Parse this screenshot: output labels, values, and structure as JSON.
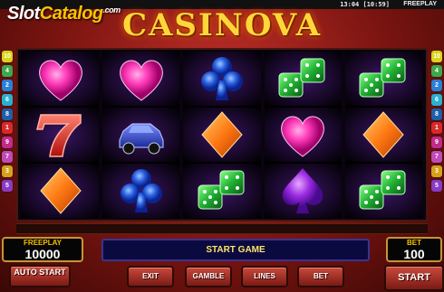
{
  "topbar": {
    "time": "13:04 [10:59]",
    "mode": "FREEPLAY"
  },
  "watermark": {
    "part1": "Slot",
    "part2": "Catalog",
    "suffix": ".com"
  },
  "logo": {
    "text": "CASINOVA"
  },
  "paylines": {
    "left": [
      {
        "n": "10",
        "color": "#d8d31a"
      },
      {
        "n": "4",
        "color": "#3ea84a"
      },
      {
        "n": "2",
        "color": "#2a7fd6"
      },
      {
        "n": "6",
        "color": "#2ab0d0"
      },
      {
        "n": "8",
        "color": "#1e5fa8"
      },
      {
        "n": "1",
        "color": "#d62a2a"
      },
      {
        "n": "9",
        "color": "#c12a8a"
      },
      {
        "n": "7",
        "color": "#c04ab8"
      },
      {
        "n": "3",
        "color": "#d6a21a"
      },
      {
        "n": "5",
        "color": "#8a3ac4"
      }
    ],
    "right": [
      {
        "n": "10",
        "color": "#d8d31a"
      },
      {
        "n": "4",
        "color": "#3ea84a"
      },
      {
        "n": "2",
        "color": "#2a7fd6"
      },
      {
        "n": "6",
        "color": "#2ab0d0"
      },
      {
        "n": "8",
        "color": "#1e5fa8"
      },
      {
        "n": "1",
        "color": "#d62a2a"
      },
      {
        "n": "9",
        "color": "#c12a8a"
      },
      {
        "n": "7",
        "color": "#c04ab8"
      },
      {
        "n": "3",
        "color": "#d6a21a"
      },
      {
        "n": "5",
        "color": "#8a3ac4"
      }
    ]
  },
  "reels": [
    [
      "heart-symbol",
      "seven-symbol",
      "diamond-symbol"
    ],
    [
      "heart-symbol",
      "car-symbol",
      "club-symbol"
    ],
    [
      "club-symbol",
      "diamond-symbol",
      "dice-symbol"
    ],
    [
      "dice-symbol",
      "heart-symbol",
      "spade-symbol"
    ],
    [
      "dice-symbol",
      "diamond-symbol",
      "dice-symbol"
    ]
  ],
  "freeplay": {
    "label": "FREEPLAY",
    "value": "10000"
  },
  "message": "START GAME",
  "bet": {
    "label": "BET",
    "value": "100"
  },
  "buttons": {
    "autostart": "AUTO START",
    "exit": "EXIT",
    "gamble": "GAMBLE",
    "lines": "LINES",
    "bet": "BET",
    "start": "START"
  },
  "colors": {
    "panel_border": "#c69535",
    "label_yellow": "#f5c400"
  }
}
